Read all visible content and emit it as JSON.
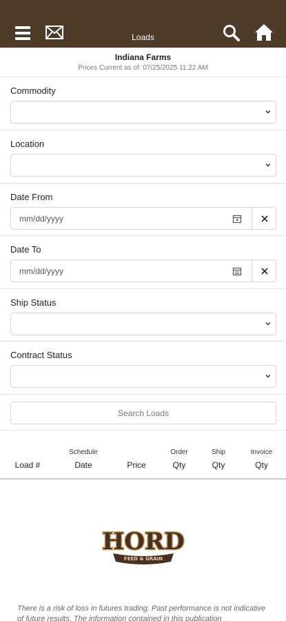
{
  "header": {
    "title": "Loads",
    "bg_color": "#4e3b2a"
  },
  "info": {
    "farm_name": "Indiana Farms",
    "prices_current": "Prices Current as of: 07/25/2025 11:22 AM"
  },
  "filters": {
    "commodity_label": "Commodity",
    "location_label": "Location",
    "date_from_label": "Date From",
    "date_from_placeholder": "mm/dd/yyyy",
    "date_to_label": "Date To",
    "date_to_placeholder": "mm/dd/yyyy",
    "ship_status_label": "Ship Status",
    "contract_status_label": "Contract Status",
    "search_button": "Search Loads"
  },
  "table": {
    "columns": [
      {
        "top": "",
        "bottom": "Load #"
      },
      {
        "top": "Schedule",
        "bottom": "Date"
      },
      {
        "top": "",
        "bottom": "Price"
      },
      {
        "top": "Order",
        "bottom": "Qty"
      },
      {
        "top": "Ship",
        "bottom": "Qty"
      },
      {
        "top": "Invoice",
        "bottom": "Qty"
      }
    ]
  },
  "footer": {
    "logo_text": "HORD",
    "logo_subtext": "FEED & GRAIN",
    "disclaimer": "There is a risk of loss in futures trading. Past performance is not indicative of future results. The information contained in this publication"
  }
}
